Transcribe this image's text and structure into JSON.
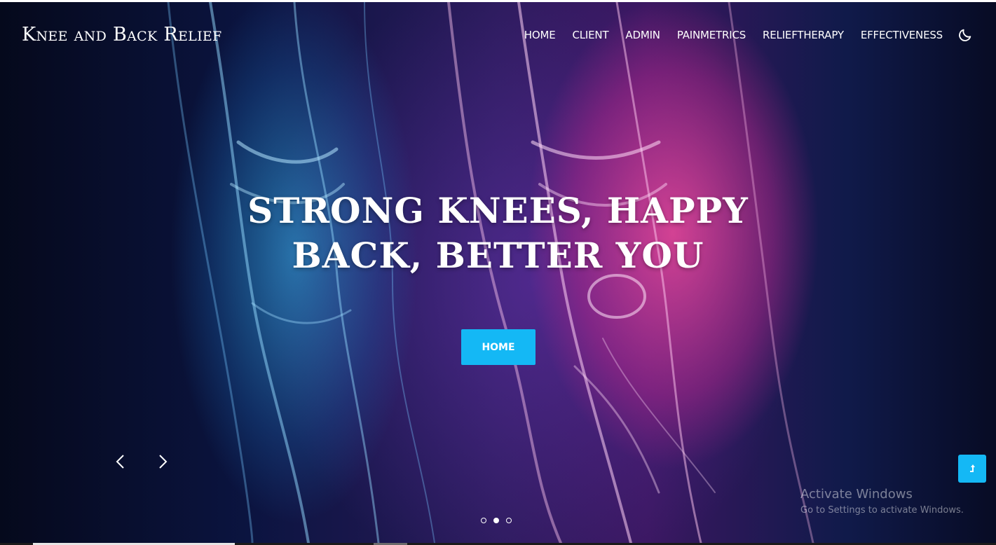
{
  "brand": {
    "name": "Knee and Back Relief"
  },
  "nav": {
    "items": [
      "HOME",
      "CLIENT",
      "ADMIN",
      "PAINMETRICS",
      "RELIEFTHERAPY",
      "EFFECTIVENESS"
    ],
    "theme_toggle_icon": "moon-icon"
  },
  "hero": {
    "headline_line1": "STRONG KNEES, HAPPY",
    "headline_line2": "BACK, BETTER YOU",
    "button_label": "HOME",
    "prev_icon": "chevron-left-icon",
    "next_icon": "chevron-right-icon",
    "slide_count": 3,
    "active_slide": 2
  },
  "back_to_top_icon": "arrow-up-icon",
  "watermark": {
    "title": "Activate Windows",
    "subtitle": "Go to Settings to activate Windows."
  },
  "colors": {
    "accent": "#14b8f5",
    "text": "#ffffff"
  }
}
